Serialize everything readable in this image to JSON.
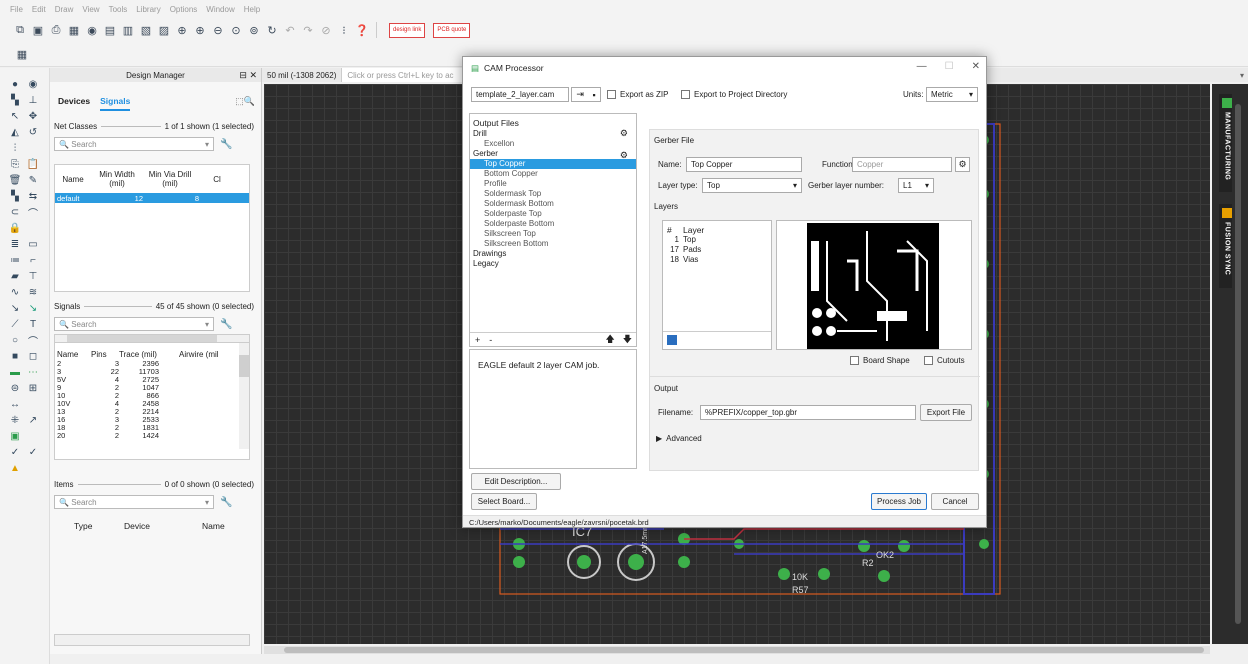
{
  "menu": [
    "File",
    "Edit",
    "Draw",
    "View",
    "Tools",
    "Library",
    "Options",
    "Window",
    "Help"
  ],
  "toolbar_badges": [
    "design link",
    "PCB quote"
  ],
  "design_manager": {
    "title": "Design Manager",
    "tabs": [
      "Devices",
      "Signals"
    ],
    "net_classes": {
      "label": "Net Classes",
      "summary": "1 of 1 shown (1 selected)",
      "search_placeholder": "Search",
      "columns": [
        "Name",
        "Min Width (mil)",
        "Min Via Drill (mil)",
        "Cl"
      ],
      "rows": [
        {
          "name": "default",
          "width": "12",
          "drill": "8"
        }
      ]
    },
    "signals": {
      "label": "Signals",
      "summary": "45 of 45 shown (0 selected)",
      "search_placeholder": "Search",
      "columns": [
        "Name",
        "Pins",
        "Trace (mil)",
        "Airwire (mil"
      ],
      "rows": [
        [
          "2",
          "3",
          "2396"
        ],
        [
          "3",
          "22",
          "11703"
        ],
        [
          "5V",
          "4",
          "2725"
        ],
        [
          "9",
          "2",
          "1047"
        ],
        [
          "10",
          "2",
          "866"
        ],
        [
          "10V",
          "4",
          "2458"
        ],
        [
          "13",
          "2",
          "2214"
        ],
        [
          "16",
          "3",
          "2533"
        ],
        [
          "18",
          "2",
          "1831"
        ],
        [
          "20",
          "2",
          "1424"
        ]
      ]
    },
    "items": {
      "label": "Items",
      "summary": "0 of 0 shown (0 selected)",
      "search_placeholder": "Search",
      "columns": [
        "Type",
        "Device",
        "Name"
      ]
    }
  },
  "canvas_bar": {
    "coord": "50 mil (-1308 2062)",
    "command_placeholder": "Click or press Ctrl+L key to ac"
  },
  "side_tabs": [
    "MANUFACTURING",
    "FUSION SYNC"
  ],
  "cam": {
    "title": "CAM Processor",
    "file": "template_2_layer.cam",
    "export_zip": "Export as ZIP",
    "export_project": "Export to Project Directory",
    "units_label": "Units:",
    "units_value": "Metric",
    "output_files_label": "Output Files",
    "tree": [
      {
        "t": "Drill",
        "lvl": 0
      },
      {
        "t": "Excellon",
        "lvl": 1
      },
      {
        "t": "Gerber",
        "lvl": 0
      },
      {
        "t": "Top Copper",
        "lvl": 1,
        "sel": true
      },
      {
        "t": "Bottom Copper",
        "lvl": 1
      },
      {
        "t": "Profile",
        "lvl": 1
      },
      {
        "t": "Soldermask Top",
        "lvl": 1
      },
      {
        "t": "Soldermask Bottom",
        "lvl": 1
      },
      {
        "t": "Solderpaste Top",
        "lvl": 1
      },
      {
        "t": "Solderpaste Bottom",
        "lvl": 1
      },
      {
        "t": "Silkscreen Top",
        "lvl": 1
      },
      {
        "t": "Silkscreen Bottom",
        "lvl": 1
      },
      {
        "t": "Drawings",
        "lvl": 0
      },
      {
        "t": "Legacy",
        "lvl": 0
      }
    ],
    "description": "EAGLE default 2 layer CAM job.",
    "gerber_file_label": "Gerber File",
    "name_label": "Name:",
    "name_value": "Top Copper",
    "function_label": "Function:",
    "function_value": "Copper",
    "layer_type_label": "Layer type:",
    "layer_type_value": "Top",
    "gerber_layer_label": "Gerber layer number:",
    "gerber_layer_value": "L1",
    "layers_label": "Layers",
    "layers_header": [
      "#",
      "Layer"
    ],
    "layers": [
      [
        "1",
        "Top"
      ],
      [
        "17",
        "Pads"
      ],
      [
        "18",
        "Vias"
      ]
    ],
    "board_shape": "Board Shape",
    "cutouts": "Cutouts",
    "output_label": "Output",
    "filename_label": "Filename:",
    "filename_value": "%PREFIX/copper_top.gbr",
    "export_file": "Export File",
    "advanced": "Advanced",
    "edit_description": "Edit Description...",
    "select_board": "Select Board...",
    "process_job": "Process Job",
    "cancel": "Cancel",
    "path": "C:/Users/marko/Documents/eagle/zavrsni/pocetak.brd"
  },
  "canvas_labels": [
    "IC7",
    "A17.5mm",
    "10K",
    "R57",
    "R2",
    "OK2"
  ]
}
